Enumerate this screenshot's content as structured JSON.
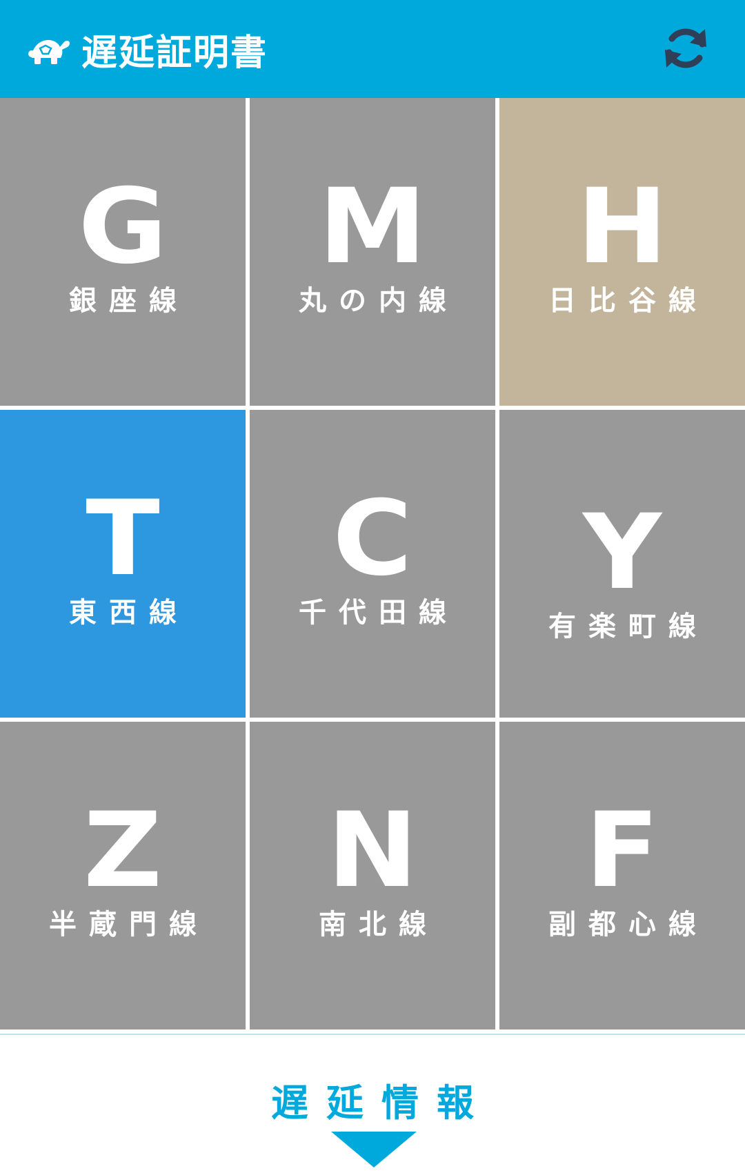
{
  "header": {
    "title": "遅延証明書",
    "logo_icon": "turtle-logo-icon",
    "refresh_icon": "refresh-icon",
    "background_color": "#00a9dc"
  },
  "lines": [
    {
      "letter": "G",
      "name": "銀座線",
      "color": "#999999"
    },
    {
      "letter": "M",
      "name": "丸の内線",
      "color": "#999999"
    },
    {
      "letter": "H",
      "name": "日比谷線",
      "color": "#c2b59b"
    },
    {
      "letter": "T",
      "name": "東西線",
      "color": "#2d97df"
    },
    {
      "letter": "C",
      "name": "千代田線",
      "color": "#999999"
    },
    {
      "letter": "Y",
      "name": "有楽町線",
      "color": "#999999"
    },
    {
      "letter": "Z",
      "name": "半蔵門線",
      "color": "#999999"
    },
    {
      "letter": "N",
      "name": "南北線",
      "color": "#999999"
    },
    {
      "letter": "F",
      "name": "副都心線",
      "color": "#999999"
    }
  ],
  "footer": {
    "label": "遅延情報",
    "arrow_icon": "down-triangle-icon",
    "color": "#00a9dc"
  }
}
